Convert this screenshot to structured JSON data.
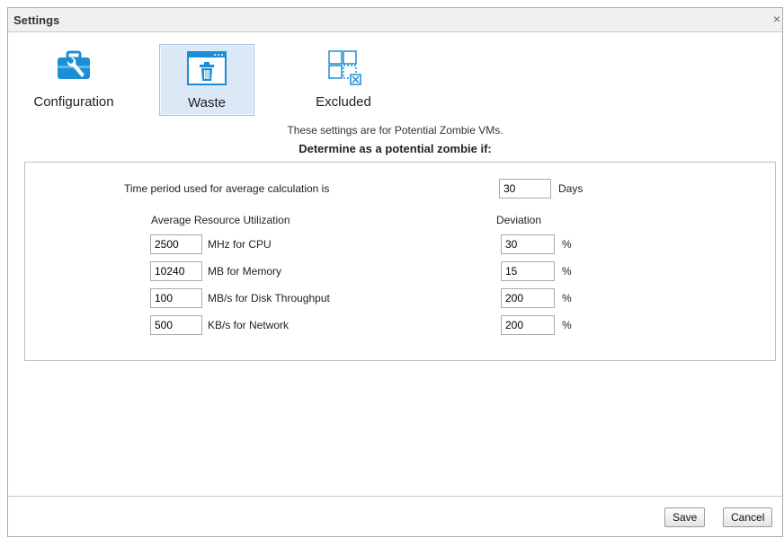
{
  "dialog": {
    "title": "Settings",
    "close_glyph": "×"
  },
  "tabs": [
    {
      "label": "Configuration",
      "icon": "toolbox-icon",
      "active": false
    },
    {
      "label": "Waste",
      "icon": "trash-window-icon",
      "active": true
    },
    {
      "label": "Excluded",
      "icon": "excluded-grid-icon",
      "active": false
    }
  ],
  "intro": {
    "line1": "These settings are for Potential Zombie VMs.",
    "line2": "Determine as a potential zombie if:"
  },
  "time_period": {
    "label": "Time period used for average calculation is",
    "value": "30",
    "unit": "Days"
  },
  "headers": {
    "utilization": "Average Resource Utilization",
    "deviation": "Deviation"
  },
  "rows": [
    {
      "value": "2500",
      "label": "MHz for CPU",
      "deviation": "30",
      "deviation_unit": "%"
    },
    {
      "value": "10240",
      "label": "MB for Memory",
      "deviation": "15",
      "deviation_unit": "%"
    },
    {
      "value": "100",
      "label": "MB/s for Disk Throughput",
      "deviation": "200",
      "deviation_unit": "%"
    },
    {
      "value": "500",
      "label": "KB/s for Network",
      "deviation": "200",
      "deviation_unit": "%"
    }
  ],
  "buttons": {
    "save": "Save",
    "cancel": "Cancel"
  },
  "colors": {
    "icon_blue": "#1a8fd6",
    "active_tab_bg": "#dbe8f6"
  }
}
